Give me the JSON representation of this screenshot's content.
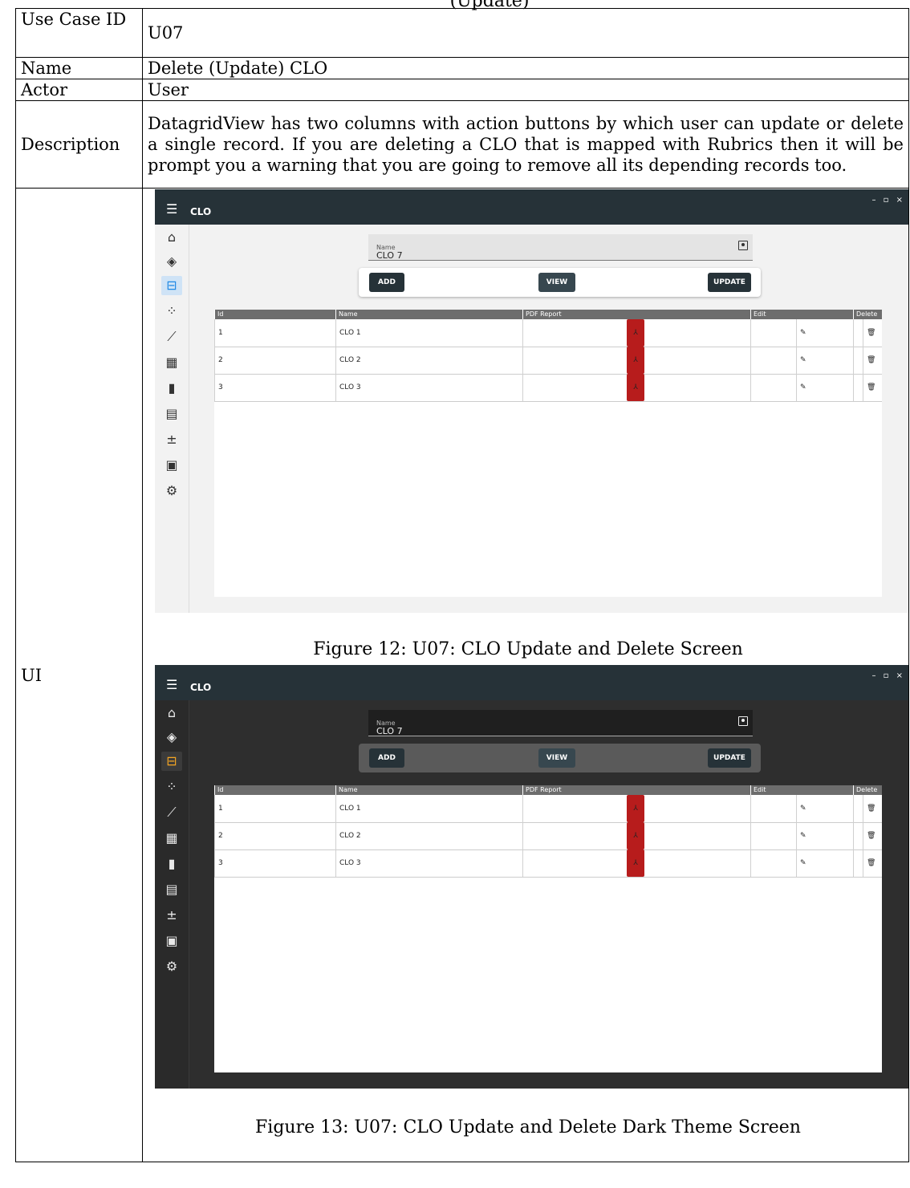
{
  "clipped_heading": "(Update)",
  "table": {
    "rows": [
      {
        "key": "Use Case ID",
        "value": "U07"
      },
      {
        "key": "Name",
        "value": "Delete (Update) CLO"
      },
      {
        "key": "Actor",
        "value": "User"
      },
      {
        "key": "Description",
        "value": "DatagridView has two columns with action buttons by which user can update or delete a single record. If you are deleting a CLO that is mapped with Rubrics then it will be prompt you a warning that you are going to remove all its depending records too."
      }
    ],
    "ui_key": "UI"
  },
  "app": {
    "title": "CLO",
    "window_controls": "– ▫ ×",
    "sidebar_icons": [
      "home-icon",
      "graduation-cap-icon",
      "hierarchy-icon",
      "scatter-icon",
      "ruler-icon",
      "calendar-icon",
      "cards-icon",
      "calculator-icon",
      "math-ops-icon",
      "pdf-document-icon",
      "settings-icon"
    ],
    "name_field": {
      "label": "Name",
      "value": "CLO 7"
    },
    "buttons": {
      "add": "ADD",
      "view": "VIEW",
      "update": "UPDATE"
    },
    "grid": {
      "columns": [
        "Id",
        "Name",
        "PDF Report",
        "Edit",
        "Delete"
      ],
      "rows": [
        {
          "id": "1",
          "name": "CLO 1"
        },
        {
          "id": "2",
          "name": "CLO 2"
        },
        {
          "id": "3",
          "name": "CLO 3"
        }
      ]
    },
    "theme_colors": {
      "titlebar": "#263238",
      "light_accent": "#1e88e5",
      "dark_accent": "#f5a623",
      "pdf_red": "#b71c1c"
    }
  },
  "captions": {
    "fig12": "Figure 12: U07: CLO Update and Delete Screen",
    "fig13": "Figure 13: U07: CLO Update and Delete Dark Theme Screen"
  }
}
